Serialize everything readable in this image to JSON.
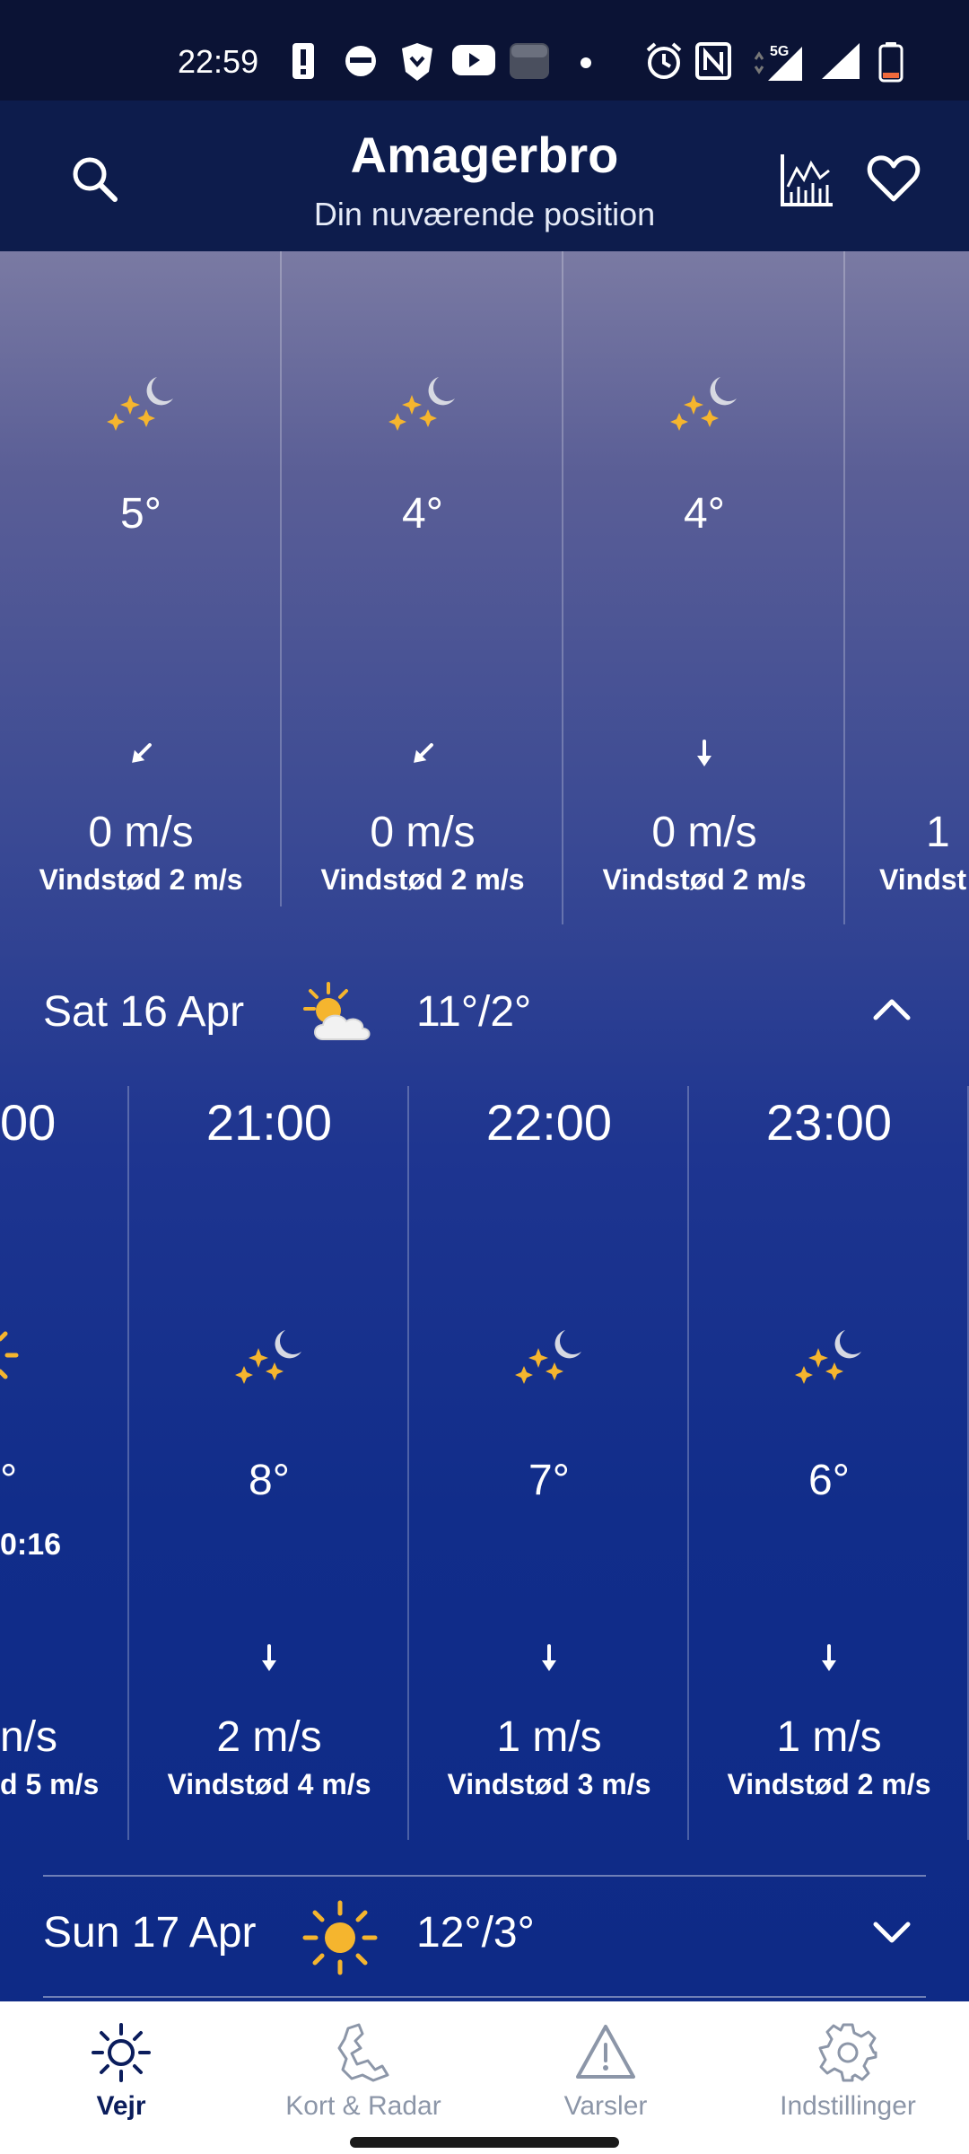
{
  "status_bar": {
    "time": "22:59",
    "network": "5G"
  },
  "header": {
    "title": "Amagerbro",
    "subtitle": "Din nuværende position",
    "icons": [
      "search-icon",
      "graph-icon",
      "favorite-heart-icon"
    ]
  },
  "upper_hours": [
    {
      "temp": "5°",
      "wind": "0 m/s",
      "gust": "Vindstød 2 m/s",
      "icon": "clear-night-icon",
      "wind_dir": "north-east"
    },
    {
      "temp": "4°",
      "wind": "0 m/s",
      "gust": "Vindstød 2 m/s",
      "icon": "clear-night-icon",
      "wind_dir": "north-east"
    },
    {
      "temp": "4°",
      "wind": "0 m/s",
      "gust": "Vindstød 2 m/s",
      "icon": "clear-night-icon",
      "wind_dir": "north"
    },
    {
      "temp": "",
      "wind": "1",
      "gust": "Vindst",
      "icon": "",
      "wind_dir": ""
    }
  ],
  "days": [
    {
      "date": "Sat 16 Apr",
      "temps": "11°/2°",
      "icon": "partly-cloudy-icon",
      "expanded": true
    },
    {
      "date": "Sun 17 Apr",
      "temps": "12°/3°",
      "icon": "sun-icon",
      "expanded": false
    }
  ],
  "sat_hours": [
    {
      "time": "00",
      "temp": "°",
      "extra": "0:16",
      "wind": "n/s",
      "gust": "d 5 m/s",
      "icon": "sun-icon"
    },
    {
      "time": "21:00",
      "temp": "8°",
      "wind": "2 m/s",
      "gust": "Vindstød 4 m/s",
      "icon": "clear-night-icon"
    },
    {
      "time": "22:00",
      "temp": "7°",
      "wind": "1 m/s",
      "gust": "Vindstød 3 m/s",
      "icon": "clear-night-icon"
    },
    {
      "time": "23:00",
      "temp": "6°",
      "wind": "1 m/s",
      "gust": "Vindstød 2 m/s",
      "icon": "clear-night-icon"
    }
  ],
  "bottom_nav": [
    {
      "label": "Vejr",
      "icon": "sun-outline-icon",
      "active": true
    },
    {
      "label": "Kort & Radar",
      "icon": "map-icon",
      "active": false
    },
    {
      "label": "Varsler",
      "icon": "warning-icon",
      "active": false
    },
    {
      "label": "Indstillinger",
      "icon": "gear-icon",
      "active": false
    }
  ]
}
